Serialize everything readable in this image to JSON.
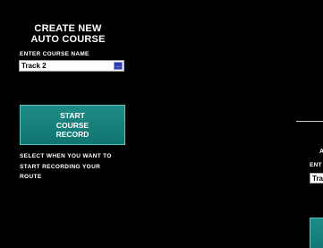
{
  "colors": {
    "background": "#000000",
    "button_teal": "#1a827e",
    "picker_blue": "#2d3fb0",
    "text": "#ffffff"
  },
  "left_panel": {
    "title_line1": "CREATE NEW",
    "title_line2": "AUTO COURSE",
    "field_label": "ENTER COURSE NAME",
    "course_name_value": "Track 2",
    "picker_button_label": "...",
    "picker_icon": "ellipsis-icon",
    "start_button_line1": "START",
    "start_button_line2": "COURSE",
    "start_button_line3": "RECORD",
    "help_line1": "SELECT WHEN YOU WANT TO",
    "help_line2": "START RECORDING YOUR",
    "help_line3": "ROUTE"
  },
  "right_panel": {
    "title_fragment": "A",
    "label_fragment": "ENT",
    "input_fragment": "Trac"
  }
}
